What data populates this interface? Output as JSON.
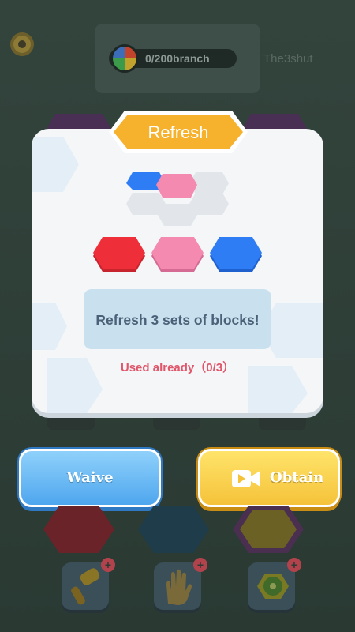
{
  "header": {
    "progress": "0/200branch",
    "player_name": "The3shut",
    "settings_icon": "gear-icon"
  },
  "dialog": {
    "title": "Refresh",
    "info": "Refresh 3 sets of blocks!",
    "usage": "Used already（0/3）",
    "block_colors": [
      "#ee2f3a",
      "#f48ab0",
      "#2f7df5"
    ]
  },
  "buttons": {
    "waive": "Waive",
    "obtain": "Obtain",
    "obtain_icon": "video-camera-icon"
  },
  "tools": [
    {
      "name": "hammer-tool",
      "icon": "hammer-icon"
    },
    {
      "name": "hand-tool",
      "icon": "hand-icon"
    },
    {
      "name": "fruit-tool",
      "icon": "kiwi-icon"
    }
  ]
}
